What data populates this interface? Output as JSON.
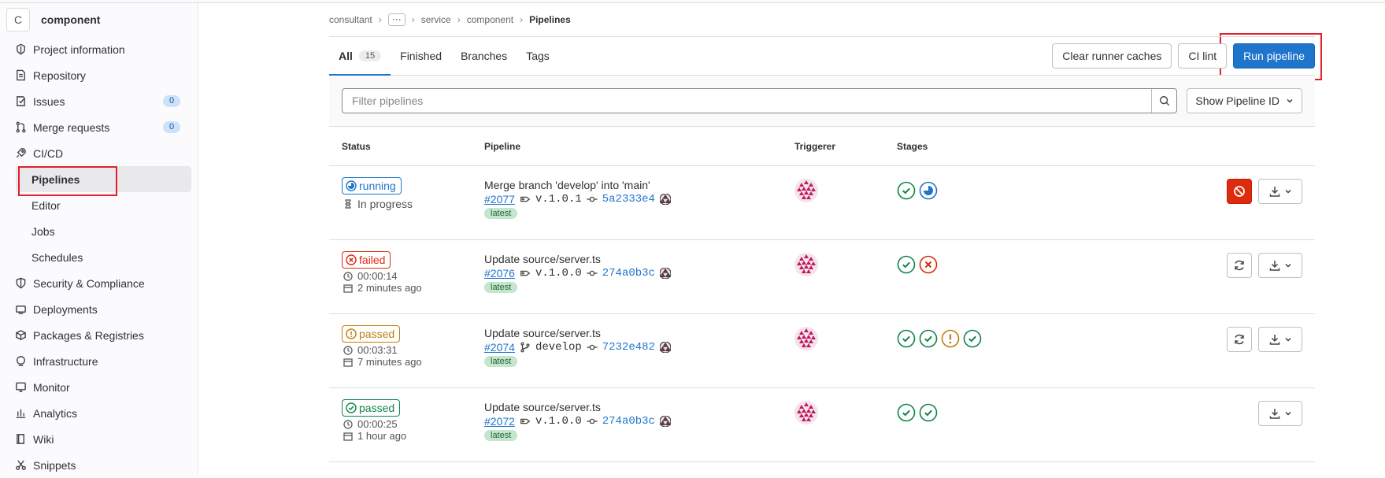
{
  "project": {
    "avatar_letter": "C",
    "name": "component"
  },
  "sidebar": {
    "items": [
      {
        "label": "Project information",
        "icon": "info-icon"
      },
      {
        "label": "Repository",
        "icon": "doc-icon"
      },
      {
        "label": "Issues",
        "icon": "issues-icon",
        "badge": "0"
      },
      {
        "label": "Merge requests",
        "icon": "merge-icon",
        "badge": "0"
      },
      {
        "label": "CI/CD",
        "icon": "rocket-icon"
      },
      {
        "label": "Pipelines"
      },
      {
        "label": "Editor"
      },
      {
        "label": "Jobs"
      },
      {
        "label": "Schedules"
      },
      {
        "label": "Security & Compliance",
        "icon": "shield-icon"
      },
      {
        "label": "Deployments",
        "icon": "deploy-icon"
      },
      {
        "label": "Packages & Registries",
        "icon": "package-icon"
      },
      {
        "label": "Infrastructure",
        "icon": "infra-icon"
      },
      {
        "label": "Monitor",
        "icon": "monitor-icon"
      },
      {
        "label": "Analytics",
        "icon": "chart-icon"
      },
      {
        "label": "Wiki",
        "icon": "book-icon"
      },
      {
        "label": "Snippets",
        "icon": "scissors-icon"
      }
    ]
  },
  "breadcrumb": {
    "items": [
      "consultant",
      "service",
      "component"
    ],
    "more": "···",
    "current": "Pipelines"
  },
  "tabs": [
    {
      "label": "All",
      "count": "15"
    },
    {
      "label": "Finished"
    },
    {
      "label": "Branches"
    },
    {
      "label": "Tags"
    }
  ],
  "toolbar": {
    "clear_label": "Clear runner caches",
    "lint_label": "CI lint",
    "run_label": "Run pipeline"
  },
  "filter": {
    "placeholder": "Filter pipelines",
    "show_label": "Show Pipeline ID"
  },
  "table": {
    "headers": {
      "status": "Status",
      "pipeline": "Pipeline",
      "triggerer": "Triggerer",
      "stages": "Stages"
    },
    "rows": [
      {
        "status": "running",
        "status_kind": "running",
        "meta1": "In progress",
        "meta2": "",
        "title": "Merge branch 'develop' into 'main'",
        "id": "#2077",
        "ref": "v.1.0.1",
        "ref_kind": "tag",
        "sha": "5a2333e4",
        "tag": "latest",
        "stages": [
          "success",
          "running"
        ],
        "action": "cancel"
      },
      {
        "status": "failed",
        "status_kind": "failed",
        "meta1": "00:00:14",
        "meta2": "2 minutes ago",
        "title": "Update source/server.ts",
        "id": "#2076",
        "ref": "v.1.0.0",
        "ref_kind": "tag",
        "sha": "274a0b3c",
        "tag": "latest",
        "stages": [
          "success",
          "failed"
        ],
        "action": "retry"
      },
      {
        "status": "passed",
        "status_kind": "warn",
        "meta1": "00:03:31",
        "meta2": "7 minutes ago",
        "title": "Update source/server.ts",
        "id": "#2074",
        "ref": "develop",
        "ref_kind": "branch",
        "sha": "7232e482",
        "tag": "latest",
        "stages": [
          "success",
          "success",
          "warning",
          "success"
        ],
        "action": "retry"
      },
      {
        "status": "passed",
        "status_kind": "passed",
        "meta1": "00:00:25",
        "meta2": "1 hour ago",
        "title": "Update source/server.ts",
        "id": "#2072",
        "ref": "v.1.0.0",
        "ref_kind": "tag",
        "sha": "274a0b3c",
        "tag": "latest",
        "stages": [
          "success",
          "success"
        ],
        "action": "none"
      }
    ]
  },
  "colors": {
    "accent": "#1f75cb",
    "danger": "#dd2b0e",
    "success": "#108548",
    "warning": "#c17d10",
    "identicon": "#c2185b"
  }
}
